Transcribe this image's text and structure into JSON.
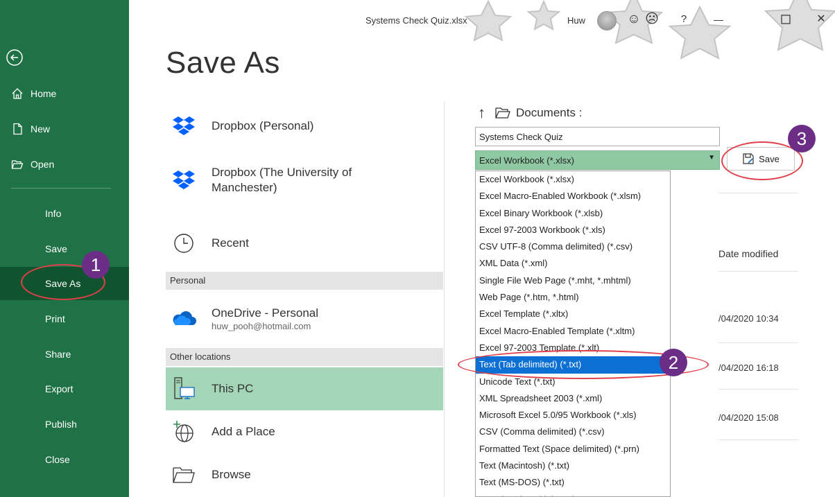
{
  "sidebar": {
    "items": [
      {
        "label": "Home"
      },
      {
        "label": "New"
      },
      {
        "label": "Open"
      },
      {
        "label": "Info"
      },
      {
        "label": "Save"
      },
      {
        "label": "Save As"
      },
      {
        "label": "Print"
      },
      {
        "label": "Share"
      },
      {
        "label": "Export"
      },
      {
        "label": "Publish"
      },
      {
        "label": "Close"
      }
    ]
  },
  "titlebar": {
    "doc_title": "Systems Check Quiz.xlsx",
    "user_name": "Huw",
    "smile_glyph": "☺",
    "frown_glyph": "☹",
    "help_glyph": "?",
    "minimize_glyph": "—",
    "close_glyph": "✕"
  },
  "page": {
    "title": "Save As"
  },
  "locations": {
    "dropbox_personal": "Dropbox (Personal)",
    "dropbox_uni": "Dropbox (The University of Manchester)",
    "recent": "Recent",
    "personal_header": "Personal",
    "onedrive": {
      "name": "OneDrive - Personal",
      "email": "huw_pooh@hotmail.com"
    },
    "other_header": "Other locations",
    "this_pc": "This PC",
    "add_place": "Add a Place",
    "browse": "Browse"
  },
  "save_pane": {
    "up_glyph": "↑",
    "folder_name": "Documents :",
    "filename_value": "Systems Check Quiz",
    "selected_type": "Excel Workbook (*.xlsx)",
    "save_label": "Save",
    "file_types": [
      "Excel Workbook (*.xlsx)",
      "Excel Macro-Enabled Workbook (*.xlsm)",
      "Excel Binary Workbook (*.xlsb)",
      "Excel 97-2003 Workbook (*.xls)",
      "CSV UTF-8 (Comma delimited) (*.csv)",
      "XML Data (*.xml)",
      "Single File Web Page (*.mht, *.mhtml)",
      "Web Page (*.htm, *.html)",
      "Excel Template (*.xltx)",
      "Excel Macro-Enabled Template (*.xltm)",
      "Excel 97-2003 Template (*.xlt)",
      "Text (Tab delimited) (*.txt)",
      "Unicode Text (*.txt)",
      "XML Spreadsheet 2003 (*.xml)",
      "Microsoft Excel 5.0/95 Workbook (*.xls)",
      "CSV (Comma delimited) (*.csv)",
      "Formatted Text (Space delimited) (*.prn)",
      "Text (Macintosh) (*.txt)",
      "Text (MS-DOS) (*.txt)",
      "CSV (Macintosh) (*.csv)"
    ],
    "selected_index_label": "Text (Tab delimited) (*.txt)",
    "date_modified_header": "Date modified",
    "dates": [
      "/04/2020 10:34",
      "/04/2020 16:18",
      "/04/2020 15:08"
    ]
  },
  "annotations": {
    "step1": "1",
    "step2": "2",
    "step3": "3"
  },
  "colors": {
    "sidebar": "#1f7246",
    "sidebar_active": "#10532f",
    "selection": "#0b6fd3",
    "badge": "#6b2d86",
    "callout": "#e0404a"
  }
}
